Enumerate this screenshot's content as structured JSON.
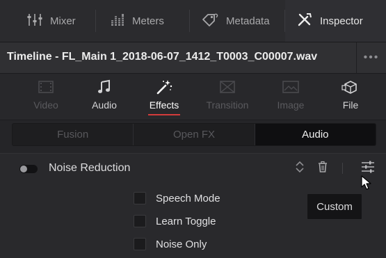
{
  "panel_tabs": [
    {
      "label": "Mixer",
      "icon": "mixer-faders-icon"
    },
    {
      "label": "Meters",
      "icon": "meters-icon"
    },
    {
      "label": "Metadata",
      "icon": "metadata-tag-icon"
    },
    {
      "label": "Inspector",
      "icon": "inspector-wand-icon",
      "active": true
    }
  ],
  "header": {
    "title": "Timeline - FL_Main 1_2018-06-07_1412_T0003_C00007.wav",
    "more": "•••"
  },
  "category_tabs": [
    {
      "label": "Video",
      "icon": "video-icon",
      "state": "disabled"
    },
    {
      "label": "Audio",
      "icon": "music-note-icon",
      "state": "enabled"
    },
    {
      "label": "Effects",
      "icon": "magic-wand-icon",
      "state": "active"
    },
    {
      "label": "Transition",
      "icon": "transition-icon",
      "state": "disabled"
    },
    {
      "label": "Image",
      "icon": "image-icon",
      "state": "disabled"
    },
    {
      "label": "File",
      "icon": "file-cube-icon",
      "state": "enabled"
    }
  ],
  "subtabs": [
    {
      "label": "Fusion",
      "active": false
    },
    {
      "label": "Open FX",
      "active": false
    },
    {
      "label": "Audio",
      "active": true
    }
  ],
  "effect": {
    "name": "Noise Reduction",
    "enabled": false,
    "options": [
      {
        "label": "Speech Mode",
        "checked": false
      },
      {
        "label": "Learn Toggle",
        "checked": false
      },
      {
        "label": "Noise Only",
        "checked": false
      }
    ]
  },
  "tooltip": {
    "text": "Custom"
  },
  "colors": {
    "accent_underline": "#d33b3b",
    "panel_bg": "#252528"
  }
}
